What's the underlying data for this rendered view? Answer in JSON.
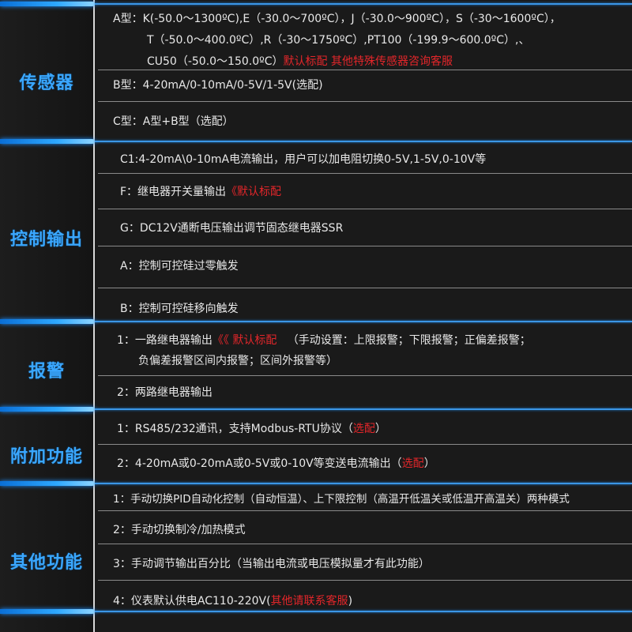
{
  "sections": [
    {
      "label": "传感器"
    },
    {
      "label": "控制输出"
    },
    {
      "label": "报警"
    },
    {
      "label": "附加功能"
    },
    {
      "label": "其他功能"
    }
  ],
  "sensor": {
    "a_line1": "A型：K(-50.0～1300ºC),E（-30.0～700ºC），J（-30.0～900ºC），S（-30～1600ºC），",
    "a_line2": "T（-50.0～400.0ºC）,R（-30～1750ºC）,PT100（-199.9～600.0ºC）,、",
    "a_line3": "CU50（-50.0～150.0ºC）",
    "a_line3_red": "默认标配   其他特殊传感器咨询客服",
    "b_line": "B型：4-20mA/0-10mA/0-5V/1-5V(选配)",
    "c_line": "C型：A型+B型（选配）"
  },
  "control": {
    "c1": "C1:4-20mA\\0-10mA电流输出，用户可以加电阻切换0-5V,1-5V,0-10V等",
    "f": "F：继电器开关量输出",
    "f_red": "《默认标配",
    "g": "G：DC12V通断电压输出调节固态继电器SSR",
    "a": "A：控制可控硅过零触发",
    "b": "B：控制可控硅移向触发"
  },
  "alarm": {
    "one_a": "1：一路继电器输出",
    "one_red": "《《 默认标配",
    "one_b": "（手动设置：上限报警；下限报警；正偏差报警；",
    "one_c": "负偏差报警区间内报警；区间外报警等）",
    "two": "2：两路继电器输出"
  },
  "addon": {
    "one": "1：RS485/232通讯，支持Modbus-RTU协议（",
    "one_red": "选配",
    "one_end": "）",
    "two": "2：4-20mA或0-20mA或0-5V或0-10V等变送电流输出（",
    "two_red": "选配",
    "two_end": "）"
  },
  "other": {
    "one": "1：手动切换PID自动化控制（自动恒温）、上下限控制（高温开低温关或低温开高温关）两种模式",
    "two": "2：手动切换制冷/加热模式",
    "three": "3：手动调节输出百分比（当输出电流或电压模拟量才有此功能）",
    "four": "4：仪表默认供电AC110-220V(",
    "four_red": "其他请联系客服",
    "four_end": ")"
  },
  "colors": {
    "accent": "#3aa7ff",
    "highlight": "#e3262a"
  }
}
